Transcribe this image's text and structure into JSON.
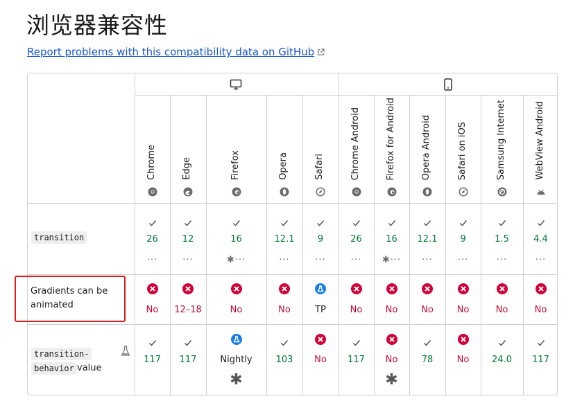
{
  "page": {
    "title": "浏览器兼容性",
    "report_link": "Report problems with this compatibility data on GitHub"
  },
  "browsers": [
    {
      "name": "Chrome",
      "icon": "chrome-icon"
    },
    {
      "name": "Edge",
      "icon": "edge-icon"
    },
    {
      "name": "Firefox",
      "icon": "firefox-icon"
    },
    {
      "name": "Opera",
      "icon": "opera-icon"
    },
    {
      "name": "Safari",
      "icon": "safari-icon"
    },
    {
      "name": "Chrome Android",
      "icon": "chrome-icon"
    },
    {
      "name": "Firefox for Android",
      "icon": "firefox-icon"
    },
    {
      "name": "Opera Android",
      "icon": "opera-icon"
    },
    {
      "name": "Safari on iOS",
      "icon": "safari-icon"
    },
    {
      "name": "Samsung Internet",
      "icon": "samsung-icon"
    },
    {
      "name": "WebView Android",
      "icon": "android-icon"
    }
  ],
  "platform_groups": [
    {
      "icon": "desktop-icon"
    },
    {
      "icon": "mobile-icon"
    }
  ],
  "rows": [
    {
      "feature_code": "transition",
      "cells": [
        {
          "status": "yes",
          "version": "26",
          "more": "···"
        },
        {
          "status": "yes",
          "version": "12",
          "more": "···"
        },
        {
          "status": "yes",
          "version": "16",
          "more": "✱···"
        },
        {
          "status": "yes",
          "version": "12.1",
          "more": "···"
        },
        {
          "status": "yes",
          "version": "9",
          "more": "···"
        },
        {
          "status": "yes",
          "version": "26",
          "more": "···"
        },
        {
          "status": "yes",
          "version": "16",
          "more": "✱···"
        },
        {
          "status": "yes",
          "version": "12.1",
          "more": "···"
        },
        {
          "status": "yes",
          "version": "9",
          "more": "···"
        },
        {
          "status": "yes",
          "version": "1.5",
          "more": "···"
        },
        {
          "status": "yes",
          "version": "4.4",
          "more": "···"
        }
      ]
    },
    {
      "feature_text": "Gradients can be animated",
      "cells": [
        {
          "status": "no",
          "version": "No"
        },
        {
          "status": "no",
          "version": "12–18"
        },
        {
          "status": "no",
          "version": "No"
        },
        {
          "status": "no",
          "version": "No"
        },
        {
          "status": "preview",
          "version": "TP"
        },
        {
          "status": "no",
          "version": "No"
        },
        {
          "status": "no",
          "version": "No"
        },
        {
          "status": "no",
          "version": "No"
        },
        {
          "status": "no",
          "version": "No"
        },
        {
          "status": "no",
          "version": "No"
        },
        {
          "status": "no",
          "version": "No"
        }
      ]
    },
    {
      "feature_code_lines": [
        "transition-",
        "behavior"
      ],
      "feature_suffix": "value",
      "experimental_icon": "flask-icon",
      "cells": [
        {
          "status": "yes",
          "version": "117"
        },
        {
          "status": "yes",
          "version": "117"
        },
        {
          "status": "preview",
          "version": "Nightly",
          "more": "✱"
        },
        {
          "status": "yes",
          "version": "103"
        },
        {
          "status": "no",
          "version": "No"
        },
        {
          "status": "yes",
          "version": "117"
        },
        {
          "status": "no",
          "version": "No",
          "more": "✱"
        },
        {
          "status": "yes",
          "version": "78"
        },
        {
          "status": "no",
          "version": "No"
        },
        {
          "status": "yes",
          "version": "24.0"
        },
        {
          "status": "yes",
          "version": "117"
        }
      ]
    }
  ],
  "colors": {
    "supported": "#007936",
    "unsupported": "#c30a36",
    "unsupported_icon": "#d30038",
    "preview_icon": "#1a7ee5",
    "link": "#1a57c9",
    "border": "#cfcfcf",
    "highlight_box": "#e01b1b"
  }
}
